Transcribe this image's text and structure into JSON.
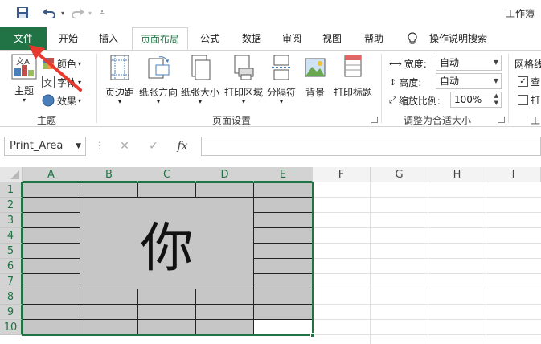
{
  "window": {
    "title": "工作簿"
  },
  "quick_access": {
    "save_icon": "save-icon",
    "undo_icon": "undo-icon",
    "redo_icon": "redo-icon",
    "customize_icon": "customize-icon"
  },
  "tabs": [
    {
      "label": "文件",
      "kind": "file"
    },
    {
      "label": "开始"
    },
    {
      "label": "插入"
    },
    {
      "label": "页面布局",
      "active": true
    },
    {
      "label": "公式"
    },
    {
      "label": "数据"
    },
    {
      "label": "审阅"
    },
    {
      "label": "视图"
    },
    {
      "label": "帮助"
    },
    {
      "label": "操作说明搜索",
      "kind": "search"
    }
  ],
  "ribbon": {
    "theme_group": {
      "label": "主题",
      "theme_button": "主题",
      "colors": "颜色",
      "fonts": "字体",
      "effects": "效果"
    },
    "page_setup_group": {
      "label": "页面设置",
      "margins": "页边距",
      "orientation": "纸张方向",
      "size": "纸张大小",
      "print_area": "打印区域",
      "breaks": "分隔符",
      "background": "背景",
      "print_titles": "打印标题"
    },
    "scale_group": {
      "label": "调整为合适大小",
      "width_label": "宽度:",
      "width_value": "自动",
      "height_label": "高度:",
      "height_value": "自动",
      "scale_label": "缩放比例:",
      "scale_value": "100%"
    },
    "sheet_options_group": {
      "label_partial": "网格线",
      "view_partial": "查",
      "print_partial": "打",
      "group_partial": "工"
    }
  },
  "formula_bar": {
    "name_box": "Print_Area",
    "cancel": "✕",
    "enter": "✓",
    "fx": "fx",
    "value": ""
  },
  "sheet": {
    "columns": [
      "A",
      "B",
      "C",
      "D",
      "E",
      "F",
      "G",
      "H",
      "I"
    ],
    "rows": [
      "1",
      "2",
      "3",
      "4",
      "5",
      "6",
      "7",
      "8",
      "9",
      "10"
    ],
    "merged_text": "你"
  },
  "colors": {
    "accent": "#217346",
    "cell_fill": "#c6c6c6",
    "arrow": "#e8392f"
  }
}
